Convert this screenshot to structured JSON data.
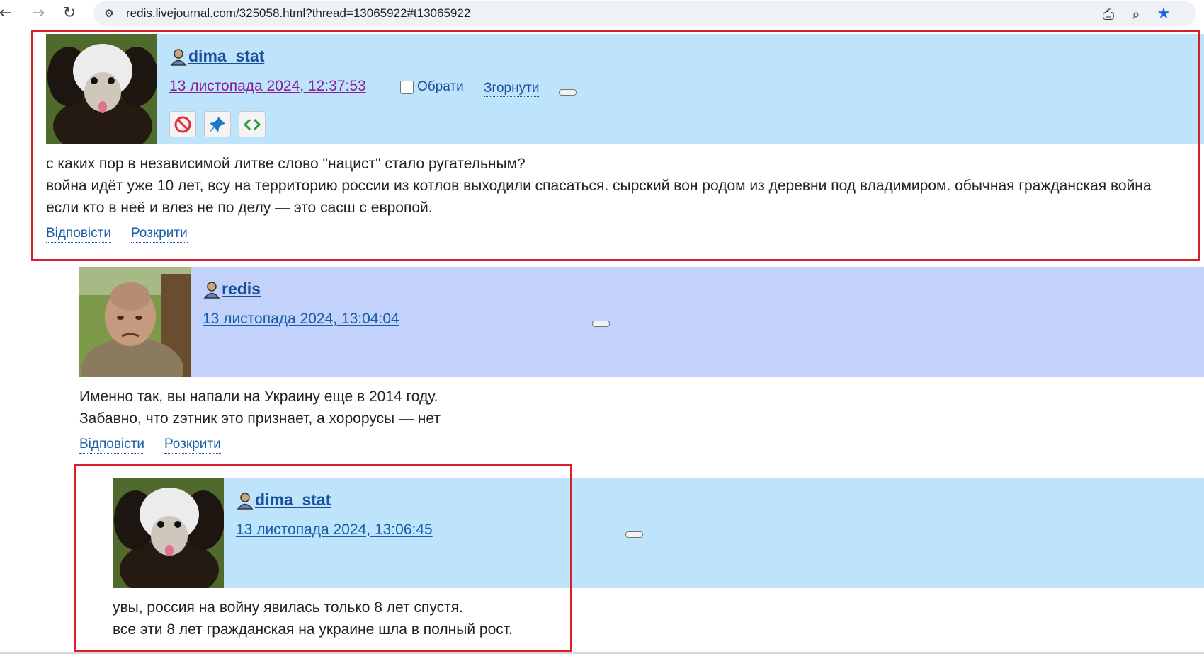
{
  "browser": {
    "url": "redis.livejournal.com/325058.html?thread=13065922#t13065922",
    "icons": [
      "back-icon",
      "forward-icon",
      "reload-icon",
      "site-info-icon",
      "install-icon",
      "zoom-icon",
      "bookmark-star-icon"
    ]
  },
  "comments": [
    {
      "username": "dima_stat",
      "timestamp": "13 листопада 2024, 12:37:53",
      "select_label": "Обрати",
      "collapse_label": "Згорнути",
      "action_icons": [
        "ban-icon",
        "pin-icon",
        "code-icon"
      ],
      "body": [
        "с каких пор в независимой литве слово \"нацист\" стало ругательным?",
        "война идёт уже 10 лет, всу на территорию россии из котлов выходили спасаться. сырский вон родом из деревни под владимиром. обычная гражданская война",
        "если кто в неё и влез не по делу — это сасш с европой."
      ],
      "reply_label": "Відповісти",
      "expand_label": "Розкрити"
    },
    {
      "username": "redis",
      "timestamp": "13 листопада 2024, 13:04:04",
      "body": [
        "Именно так, вы напали на Украину еще в 2014 году.",
        "Забавно, что zэтник это признает, а хорорусы — нет"
      ],
      "reply_label": "Відповісти",
      "expand_label": "Розкрити"
    },
    {
      "username": "dima_stat",
      "timestamp": "13 листопада 2024, 13:06:45",
      "body": [
        "увы, россия на войну явилась только 8 лет спустя.",
        "все эти 8 лет гражданская на украине шла в полный рост."
      ]
    }
  ],
  "colors": {
    "header_blue": "#bde4fb",
    "header_periwinkle": "#c3d2fb",
    "link_blue": "#1a5ca8",
    "visited_purple": "#8a2095",
    "highlight_red": "#d9202a"
  }
}
